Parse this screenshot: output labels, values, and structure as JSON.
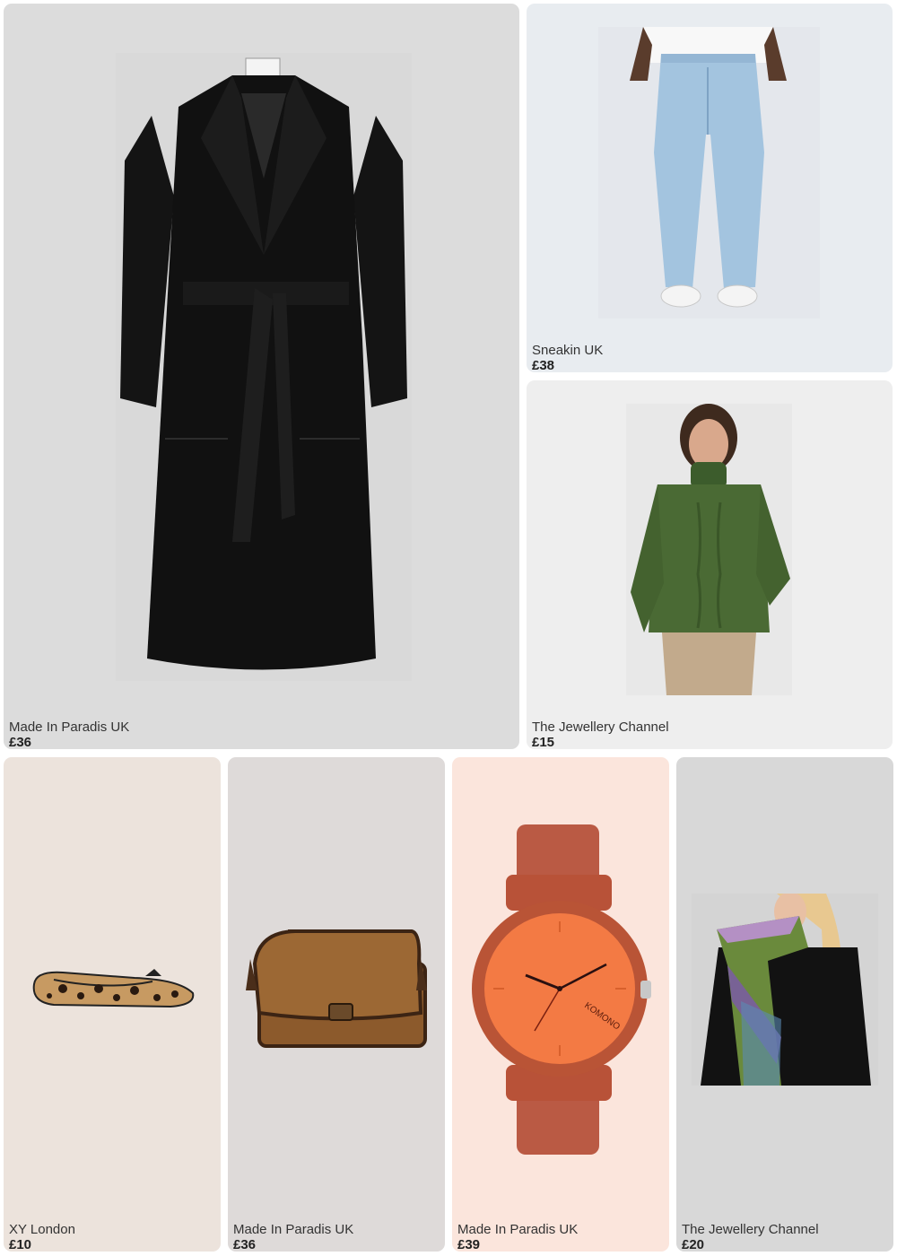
{
  "products": [
    {
      "brand": "Made In Paradis UK",
      "price": "£36",
      "item_icon": "wrap-coat-icon",
      "bg": "#dcdcdc"
    },
    {
      "brand": "Sneakin UK",
      "price": "£38",
      "item_icon": "jeans-icon",
      "bg": "#e8ecf0"
    },
    {
      "brand": "The Jewellery Channel",
      "price": "£15",
      "item_icon": "jumper-icon",
      "bg": "#eeeeee"
    },
    {
      "brand": "XY London",
      "price": "£10",
      "item_icon": "ballet-flat-icon",
      "bg": "#ece3dc"
    },
    {
      "brand": "Made In Paradis UK",
      "price": "£36",
      "item_icon": "handbag-icon",
      "bg": "#dedad9"
    },
    {
      "brand": "Made In Paradis UK",
      "price": "£39",
      "item_icon": "watch-icon",
      "bg": "#fbe5dc",
      "watch_brand": "KOMONO"
    },
    {
      "brand": "The Jewellery Channel",
      "price": "£20",
      "item_icon": "scarf-icon",
      "bg": "#d8d8d8"
    }
  ]
}
